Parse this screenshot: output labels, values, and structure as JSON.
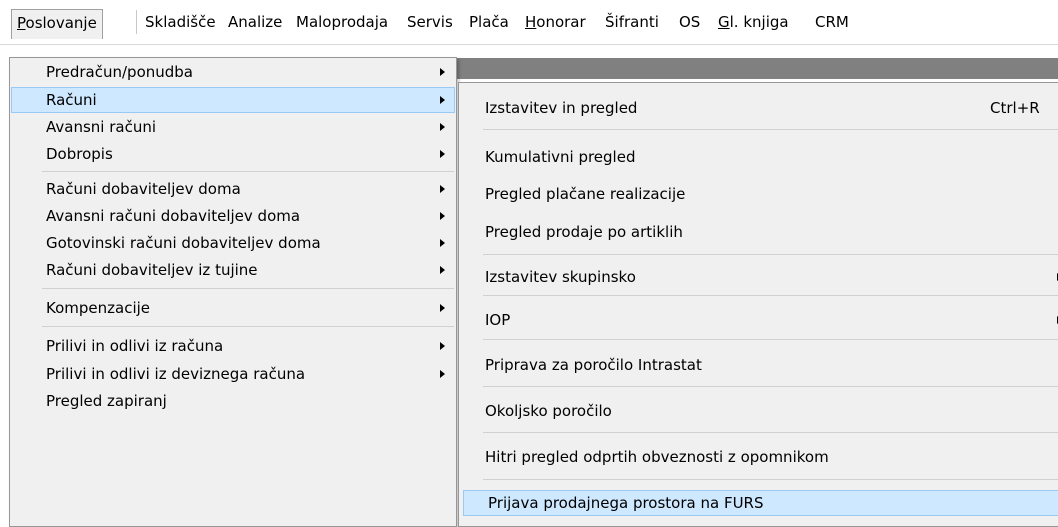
{
  "menubar": {
    "items": [
      {
        "label": "Poslovanje",
        "accel": "P"
      },
      {
        "label": "Skladišče"
      },
      {
        "label": "Analize"
      },
      {
        "label": "Maloprodaja"
      },
      {
        "label": "Servis"
      },
      {
        "label": "Plača"
      },
      {
        "label": "Honorar",
        "accel": "H"
      },
      {
        "label": "Šifranti"
      },
      {
        "label": "OS"
      },
      {
        "label": "Gl. knjiga",
        "accel": "G"
      },
      {
        "label": "CRM"
      }
    ]
  },
  "main_menu": {
    "items": [
      {
        "label": "Predračun/ponudba"
      },
      {
        "label": "Računi"
      },
      {
        "label": "Avansni računi"
      },
      {
        "label": "Dobropis"
      },
      {
        "label": "Računi dobaviteljev doma"
      },
      {
        "label": "Avansni računi dobaviteljev doma"
      },
      {
        "label": "Gotovinski računi dobaviteljev doma"
      },
      {
        "label": "Računi dobaviteljev iz tujine"
      },
      {
        "label": "Kompenzacije"
      },
      {
        "label": "Prilivi in odlivi iz računa"
      },
      {
        "label": "Prilivi in odlivi iz deviznega računa"
      },
      {
        "label": "Pregled zapiranj"
      }
    ]
  },
  "submenu": {
    "items": [
      {
        "label": "Izstavitev in pregled",
        "shortcut": "Ctrl+R"
      },
      {
        "label": "Kumulativni pregled"
      },
      {
        "label": "Pregled plačane realizacije"
      },
      {
        "label": "Pregled prodaje po artiklih"
      },
      {
        "label": "Izstavitev skupinsko"
      },
      {
        "label": "IOP"
      },
      {
        "label": "Priprava za poročilo Intrastat"
      },
      {
        "label": "Okoljsko poročilo"
      },
      {
        "label": "Hitri pregled odprtih obveznosti z opomnikom"
      },
      {
        "label": "Prijava prodajnega prostora na FURS"
      }
    ]
  },
  "colors": {
    "highlight_bg": "#cde8ff",
    "highlight_border": "#99c9f5",
    "menu_bg": "#f0f0f0",
    "strip": "#808080"
  }
}
